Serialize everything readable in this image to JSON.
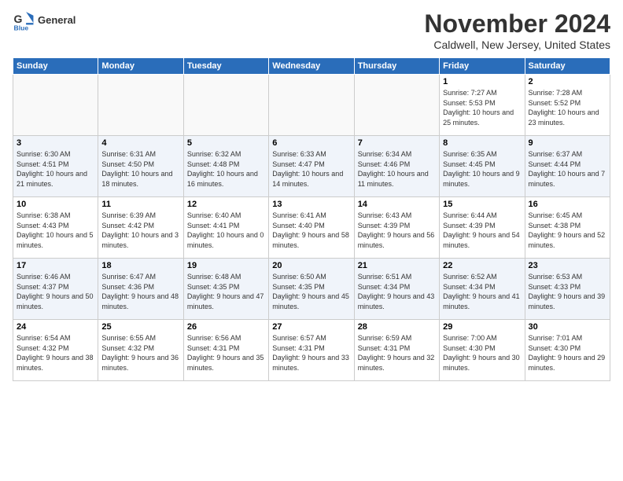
{
  "header": {
    "logo_line1": "General",
    "logo_line2": "Blue",
    "month_title": "November 2024",
    "location": "Caldwell, New Jersey, United States"
  },
  "weekdays": [
    "Sunday",
    "Monday",
    "Tuesday",
    "Wednesday",
    "Thursday",
    "Friday",
    "Saturday"
  ],
  "weeks": [
    [
      {
        "day": "",
        "info": ""
      },
      {
        "day": "",
        "info": ""
      },
      {
        "day": "",
        "info": ""
      },
      {
        "day": "",
        "info": ""
      },
      {
        "day": "",
        "info": ""
      },
      {
        "day": "1",
        "info": "Sunrise: 7:27 AM\nSunset: 5:53 PM\nDaylight: 10 hours and 25 minutes."
      },
      {
        "day": "2",
        "info": "Sunrise: 7:28 AM\nSunset: 5:52 PM\nDaylight: 10 hours and 23 minutes."
      }
    ],
    [
      {
        "day": "3",
        "info": "Sunrise: 6:30 AM\nSunset: 4:51 PM\nDaylight: 10 hours and 21 minutes."
      },
      {
        "day": "4",
        "info": "Sunrise: 6:31 AM\nSunset: 4:50 PM\nDaylight: 10 hours and 18 minutes."
      },
      {
        "day": "5",
        "info": "Sunrise: 6:32 AM\nSunset: 4:48 PM\nDaylight: 10 hours and 16 minutes."
      },
      {
        "day": "6",
        "info": "Sunrise: 6:33 AM\nSunset: 4:47 PM\nDaylight: 10 hours and 14 minutes."
      },
      {
        "day": "7",
        "info": "Sunrise: 6:34 AM\nSunset: 4:46 PM\nDaylight: 10 hours and 11 minutes."
      },
      {
        "day": "8",
        "info": "Sunrise: 6:35 AM\nSunset: 4:45 PM\nDaylight: 10 hours and 9 minutes."
      },
      {
        "day": "9",
        "info": "Sunrise: 6:37 AM\nSunset: 4:44 PM\nDaylight: 10 hours and 7 minutes."
      }
    ],
    [
      {
        "day": "10",
        "info": "Sunrise: 6:38 AM\nSunset: 4:43 PM\nDaylight: 10 hours and 5 minutes."
      },
      {
        "day": "11",
        "info": "Sunrise: 6:39 AM\nSunset: 4:42 PM\nDaylight: 10 hours and 3 minutes."
      },
      {
        "day": "12",
        "info": "Sunrise: 6:40 AM\nSunset: 4:41 PM\nDaylight: 10 hours and 0 minutes."
      },
      {
        "day": "13",
        "info": "Sunrise: 6:41 AM\nSunset: 4:40 PM\nDaylight: 9 hours and 58 minutes."
      },
      {
        "day": "14",
        "info": "Sunrise: 6:43 AM\nSunset: 4:39 PM\nDaylight: 9 hours and 56 minutes."
      },
      {
        "day": "15",
        "info": "Sunrise: 6:44 AM\nSunset: 4:39 PM\nDaylight: 9 hours and 54 minutes."
      },
      {
        "day": "16",
        "info": "Sunrise: 6:45 AM\nSunset: 4:38 PM\nDaylight: 9 hours and 52 minutes."
      }
    ],
    [
      {
        "day": "17",
        "info": "Sunrise: 6:46 AM\nSunset: 4:37 PM\nDaylight: 9 hours and 50 minutes."
      },
      {
        "day": "18",
        "info": "Sunrise: 6:47 AM\nSunset: 4:36 PM\nDaylight: 9 hours and 48 minutes."
      },
      {
        "day": "19",
        "info": "Sunrise: 6:48 AM\nSunset: 4:35 PM\nDaylight: 9 hours and 47 minutes."
      },
      {
        "day": "20",
        "info": "Sunrise: 6:50 AM\nSunset: 4:35 PM\nDaylight: 9 hours and 45 minutes."
      },
      {
        "day": "21",
        "info": "Sunrise: 6:51 AM\nSunset: 4:34 PM\nDaylight: 9 hours and 43 minutes."
      },
      {
        "day": "22",
        "info": "Sunrise: 6:52 AM\nSunset: 4:34 PM\nDaylight: 9 hours and 41 minutes."
      },
      {
        "day": "23",
        "info": "Sunrise: 6:53 AM\nSunset: 4:33 PM\nDaylight: 9 hours and 39 minutes."
      }
    ],
    [
      {
        "day": "24",
        "info": "Sunrise: 6:54 AM\nSunset: 4:32 PM\nDaylight: 9 hours and 38 minutes."
      },
      {
        "day": "25",
        "info": "Sunrise: 6:55 AM\nSunset: 4:32 PM\nDaylight: 9 hours and 36 minutes."
      },
      {
        "day": "26",
        "info": "Sunrise: 6:56 AM\nSunset: 4:31 PM\nDaylight: 9 hours and 35 minutes."
      },
      {
        "day": "27",
        "info": "Sunrise: 6:57 AM\nSunset: 4:31 PM\nDaylight: 9 hours and 33 minutes."
      },
      {
        "day": "28",
        "info": "Sunrise: 6:59 AM\nSunset: 4:31 PM\nDaylight: 9 hours and 32 minutes."
      },
      {
        "day": "29",
        "info": "Sunrise: 7:00 AM\nSunset: 4:30 PM\nDaylight: 9 hours and 30 minutes."
      },
      {
        "day": "30",
        "info": "Sunrise: 7:01 AM\nSunset: 4:30 PM\nDaylight: 9 hours and 29 minutes."
      }
    ]
  ]
}
